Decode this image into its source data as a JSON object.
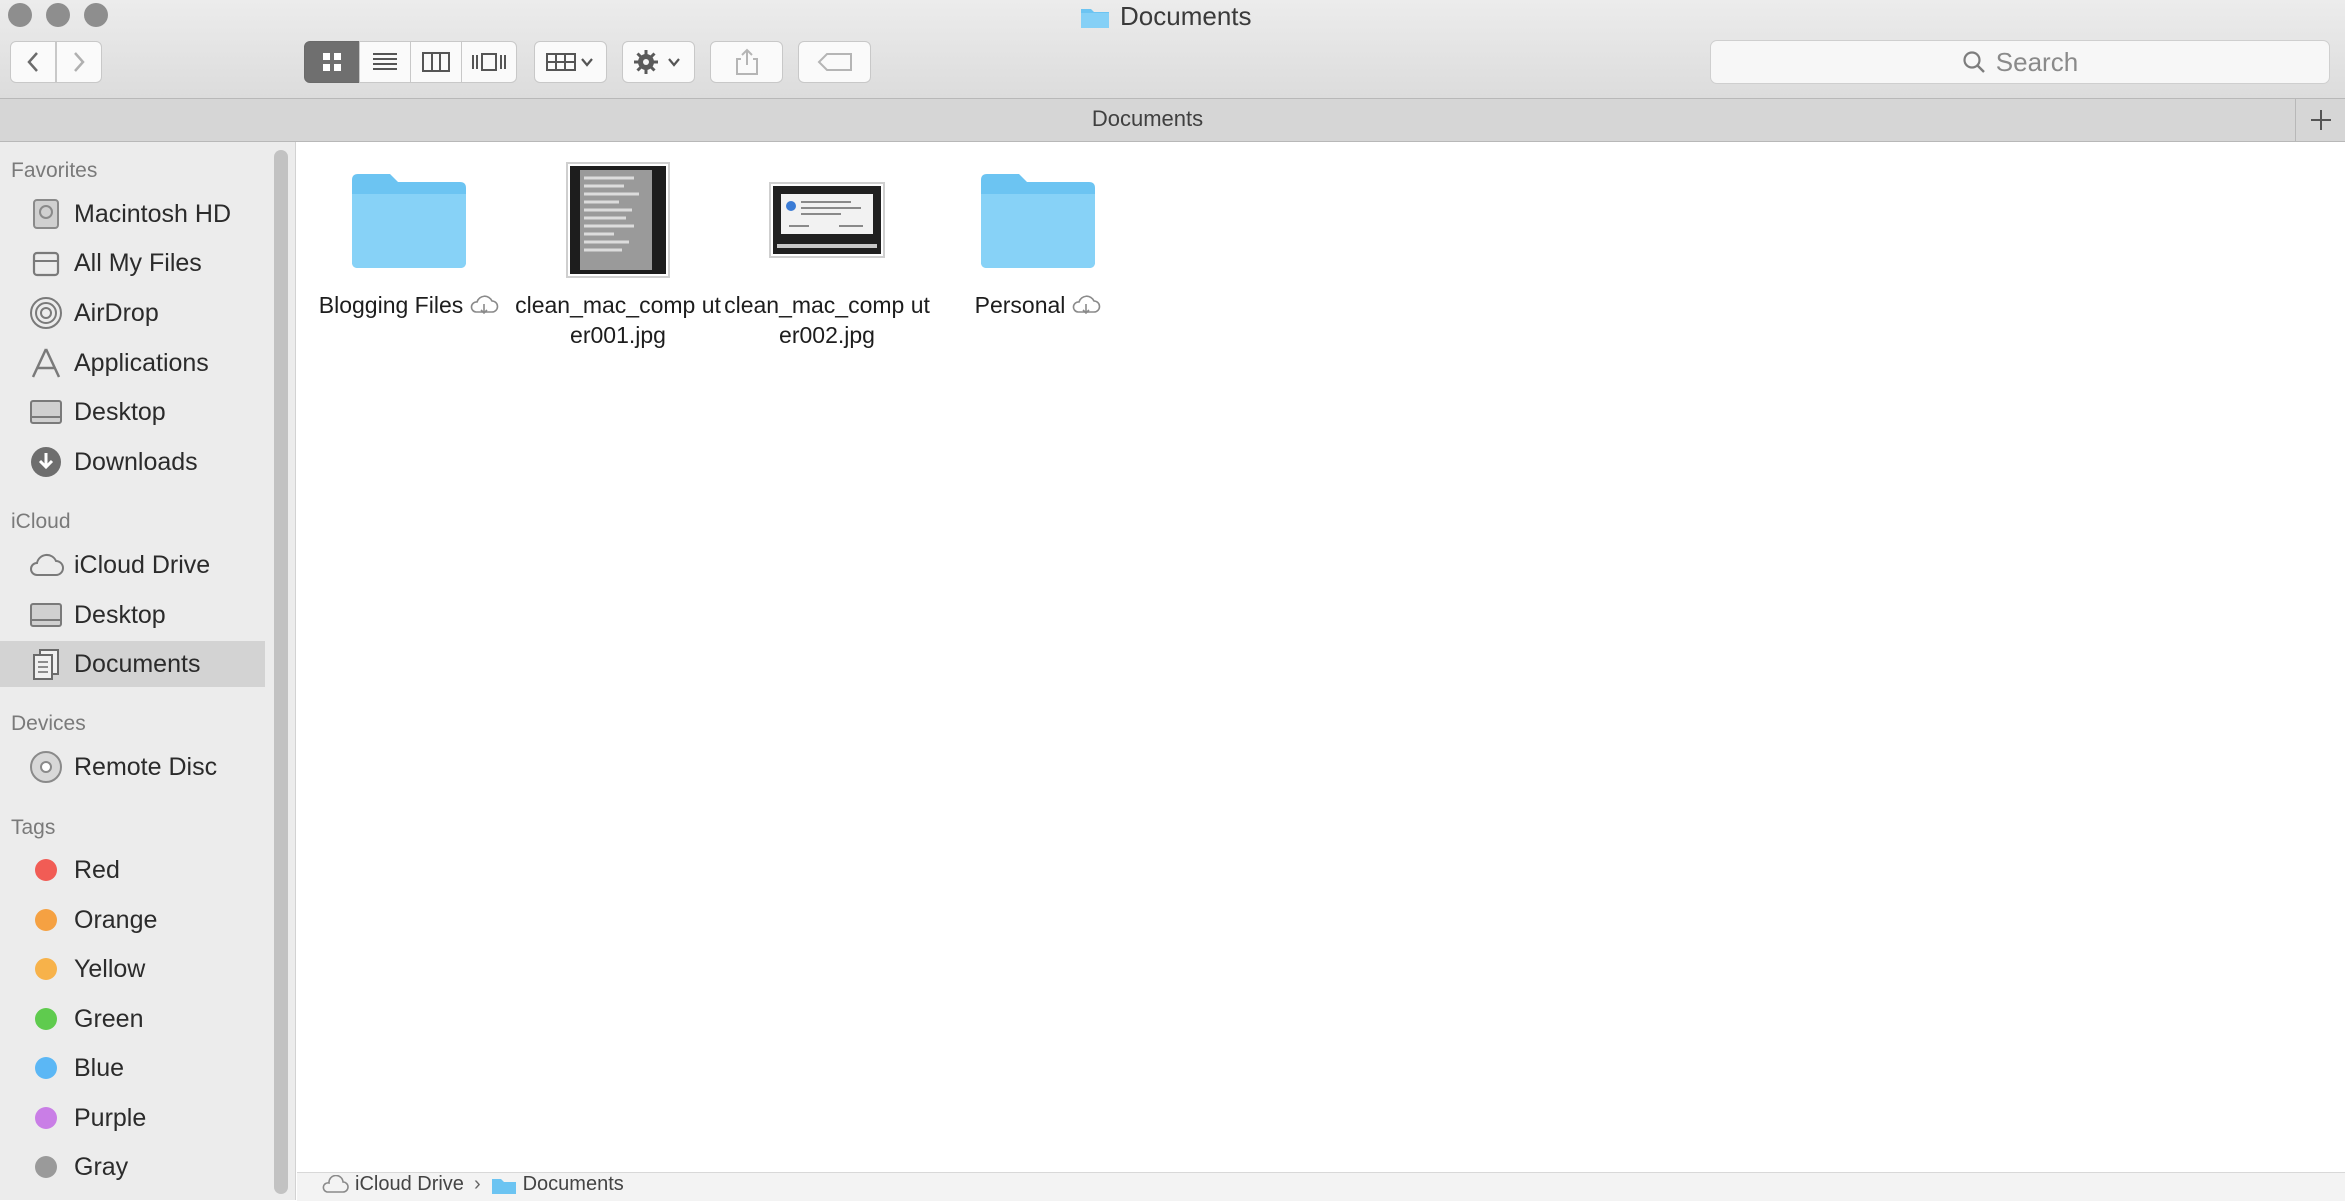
{
  "window": {
    "title": "Documents"
  },
  "toolbar": {
    "search_placeholder": "Search",
    "view_modes": [
      "icon-view",
      "list-view",
      "column-view",
      "cover-flow-view"
    ]
  },
  "tabbar": {
    "label": "Documents"
  },
  "sidebar": {
    "favorites_header": "Favorites",
    "favorites": [
      {
        "label": "Macintosh HD",
        "icon": "hard-drive-icon"
      },
      {
        "label": "All My Files",
        "icon": "all-files-icon"
      },
      {
        "label": "AirDrop",
        "icon": "airdrop-icon"
      },
      {
        "label": "Applications",
        "icon": "applications-icon"
      },
      {
        "label": "Desktop",
        "icon": "desktop-icon"
      },
      {
        "label": "Downloads",
        "icon": "downloads-icon"
      }
    ],
    "icloud_header": "iCloud",
    "icloud": [
      {
        "label": "iCloud Drive",
        "icon": "cloud-icon"
      },
      {
        "label": "Desktop",
        "icon": "desktop-icon"
      },
      {
        "label": "Documents",
        "icon": "documents-icon",
        "selected": true
      }
    ],
    "devices_header": "Devices",
    "devices": [
      {
        "label": "Remote Disc",
        "icon": "disc-icon"
      }
    ],
    "tags_header": "Tags",
    "tags": [
      {
        "label": "Red",
        "color": "#f15c55"
      },
      {
        "label": "Orange",
        "color": "#f5a142"
      },
      {
        "label": "Yellow",
        "color": "#f7b24a"
      },
      {
        "label": "Green",
        "color": "#5fcb4e"
      },
      {
        "label": "Blue",
        "color": "#5bb7f5"
      },
      {
        "label": "Purple",
        "color": "#c97ee6"
      },
      {
        "label": "Gray",
        "color": "#9a9a9a"
      }
    ]
  },
  "files": [
    {
      "name": "Blogging Files",
      "type": "folder",
      "cloud": true
    },
    {
      "name": "clean_mac_comp uter001.jpg",
      "type": "image"
    },
    {
      "name": "clean_mac_comp uter002.jpg",
      "type": "image"
    },
    {
      "name": "Personal",
      "type": "folder",
      "cloud": true
    }
  ],
  "pathbar": {
    "segments": [
      "iCloud Drive",
      "Documents"
    ]
  },
  "colors": {
    "folder": "#6cc4f2",
    "selected": "#d3d3d3"
  }
}
